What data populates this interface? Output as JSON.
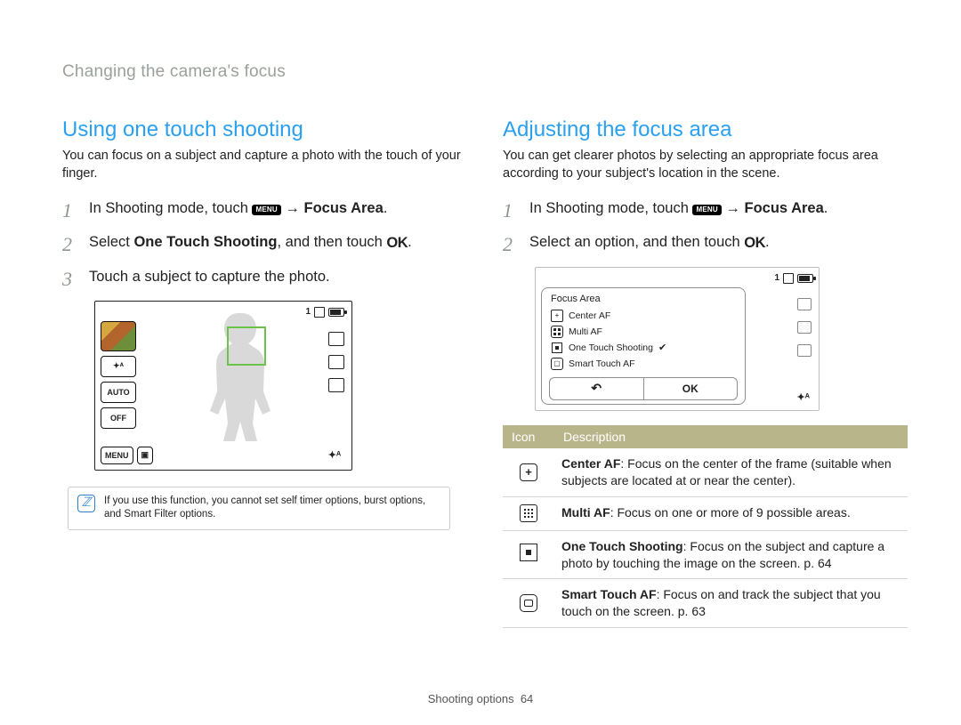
{
  "breadcrumb": "Changing the camera's focus",
  "footer": {
    "section": "Shooting options",
    "page": "64"
  },
  "icons": {
    "menu_label": "MENU",
    "ok_label": "OK",
    "back_glyph": "↶"
  },
  "left": {
    "heading": "Using one touch shooting",
    "intro": "You can focus on a subject and capture a photo with the touch of your finger.",
    "steps": {
      "s1_pre": "In Shooting mode, touch ",
      "s1_arrow": " → ",
      "s1_post": "Focus Area",
      "s1_end": ".",
      "s2_pre": "Select ",
      "s2_bold": "One Touch Shooting",
      "s2_mid": ", and then touch ",
      "s2_end": ".",
      "s3": "Touch a subject to capture the photo."
    },
    "cam": {
      "counter": "1",
      "left_buttons": [
        "✦ᴬ",
        "AUTO",
        "OFF"
      ],
      "bottom_menu": "MENU",
      "br_label": "✦ᴬ"
    },
    "note": "If you use this function, you cannot set self timer options, burst options, and Smart Filter options."
  },
  "right": {
    "heading": "Adjusting the focus area",
    "intro": "You can get clearer photos by selecting an appropriate focus area according to your subject's location in the scene.",
    "steps": {
      "s1_pre": "In Shooting mode, touch ",
      "s1_arrow": " → ",
      "s1_post": "Focus Area",
      "s1_end": ".",
      "s2_pre": "Select an option, and then touch ",
      "s2_end": "."
    },
    "dialog": {
      "counter": "1",
      "title": "Focus Area",
      "items": [
        {
          "label": "Center AF",
          "checked": false,
          "icon": "center"
        },
        {
          "label": "Multi AF",
          "checked": false,
          "icon": "grid"
        },
        {
          "label": "One Touch Shooting",
          "checked": true,
          "icon": "target"
        },
        {
          "label": "Smart Touch AF",
          "checked": false,
          "icon": "stouch"
        }
      ],
      "ok": "OK",
      "br_label": "✦ᴬ"
    },
    "table": {
      "head_icon": "Icon",
      "head_desc": "Description",
      "rows": [
        {
          "icon": "center",
          "title": "Center AF",
          "desc": ": Focus on the center of the frame (suitable when subjects are located at or near the center)."
        },
        {
          "icon": "multi",
          "title": "Multi AF",
          "desc": ": Focus on one or more of 9 possible areas."
        },
        {
          "icon": "onetouch",
          "title": "One Touch Shooting",
          "desc": ": Focus on the subject and capture a photo by touching the image on the screen. p. 64"
        },
        {
          "icon": "smart",
          "title": "Smart Touch AF",
          "desc": ": Focus on and track the subject that you touch on the screen. p. 63"
        }
      ]
    }
  }
}
